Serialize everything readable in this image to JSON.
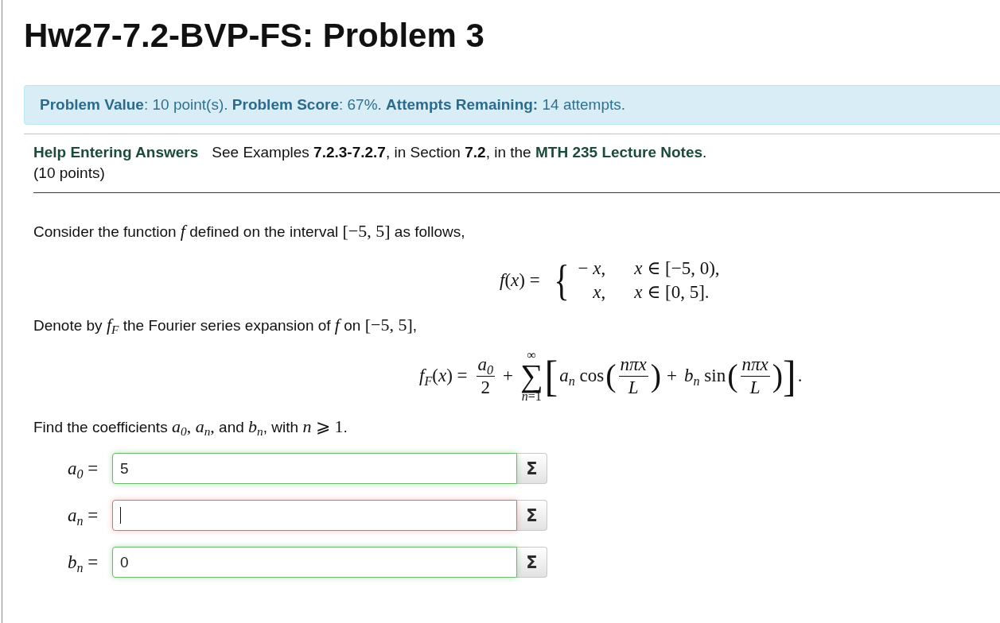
{
  "title": "Hw27-7.2-BVP-FS: Problem 3",
  "status_banner": "**Problem Value**: 10 point(s). **Problem Score**: 67%. **Attempts Remaining:** 14 attempts.",
  "help": {
    "link": "Help Entering Answers",
    "reference": {
      "before": "See Examples **7.2.3-7.2.7**, in Section **7.2**, in the ",
      "link": "MTH 235 Lecture Notes",
      "after": "."
    },
    "points": "(10 points)"
  },
  "problem": [
    {
      "kind": "paragraph",
      "segments": [
        {
          "kind": "text",
          "text": "Consider the function "
        },
        {
          "kind": "math",
          "text": "*f*"
        },
        {
          "kind": "text",
          "text": " defined on the interval "
        },
        {
          "kind": "math",
          "text": "[−5, 5]"
        },
        {
          "kind": "text",
          "text": " as follows,"
        }
      ]
    },
    {
      "kind": "piecewise",
      "lhs": "*f*(*x*) =",
      "brace": "{",
      "cases": [
        {
          "value": "− *x*,",
          "condition": "*x* ∈ [−5, 0),"
        },
        {
          "value": "*x*,",
          "condition": "*x* ∈ [0, 5]."
        }
      ]
    },
    {
      "kind": "paragraph",
      "segments": [
        {
          "kind": "text",
          "text": "Denote by "
        },
        {
          "kind": "math",
          "text": "*f*$_{F}$"
        },
        {
          "kind": "text",
          "text": " the Fourier series expansion of "
        },
        {
          "kind": "math",
          "text": "*f*"
        },
        {
          "kind": "text",
          "text": " on "
        },
        {
          "kind": "math",
          "text": "[−5, 5]"
        },
        {
          "kind": "text",
          "text": ","
        }
      ]
    },
    {
      "kind": "series",
      "lhs": "*f*$_{F}$(*x*) =",
      "parts": [
        {
          "kind": "fraction",
          "numerator": "*a*$_{0}$",
          "denominator": "2"
        },
        {
          "kind": "operator",
          "text": "+"
        },
        {
          "kind": "sum",
          "symbol": "∑",
          "upper": "∞",
          "lower": "*n*=1"
        },
        {
          "kind": "bracket",
          "text": "["
        },
        {
          "kind": "term",
          "text": "*a*$_{n}$ cos"
        },
        {
          "kind": "paren",
          "text": "("
        },
        {
          "kind": "fraction",
          "numerator": "*nπx*",
          "denominator": "*L*"
        },
        {
          "kind": "paren",
          "text": ")"
        },
        {
          "kind": "operator",
          "text": "+"
        },
        {
          "kind": "term",
          "text": "*b*$_{n}$ sin"
        },
        {
          "kind": "paren",
          "text": "("
        },
        {
          "kind": "fraction",
          "numerator": "*nπx*",
          "denominator": "*L*"
        },
        {
          "kind": "paren",
          "text": ")"
        },
        {
          "kind": "bracket",
          "text": "]"
        },
        {
          "kind": "term",
          "text": "."
        }
      ]
    },
    {
      "kind": "paragraph",
      "segments": [
        {
          "kind": "text",
          "text": "Find the coefficients "
        },
        {
          "kind": "math",
          "text": "*a*$_{0}$, *a*$_{n}$,"
        },
        {
          "kind": "text",
          "text": " and "
        },
        {
          "kind": "math",
          "text": "*b*$_{n}$"
        },
        {
          "kind": "text",
          "text": ", with "
        },
        {
          "kind": "math",
          "text": "*n* ⩾ 1"
        },
        {
          "kind": "text",
          "text": "."
        }
      ]
    }
  ],
  "answers": [
    {
      "label": "*a*$_{0}$ =",
      "value": "5",
      "correct": true,
      "focused": false,
      "button": "Σ"
    },
    {
      "label": "*a*$_{n}$ =",
      "correct": false,
      "focused": true,
      "button": "Σ"
    },
    {
      "label": "*b*$_{n}$ =",
      "value": "0",
      "correct": true,
      "focused": false,
      "button": "Σ"
    }
  ]
}
